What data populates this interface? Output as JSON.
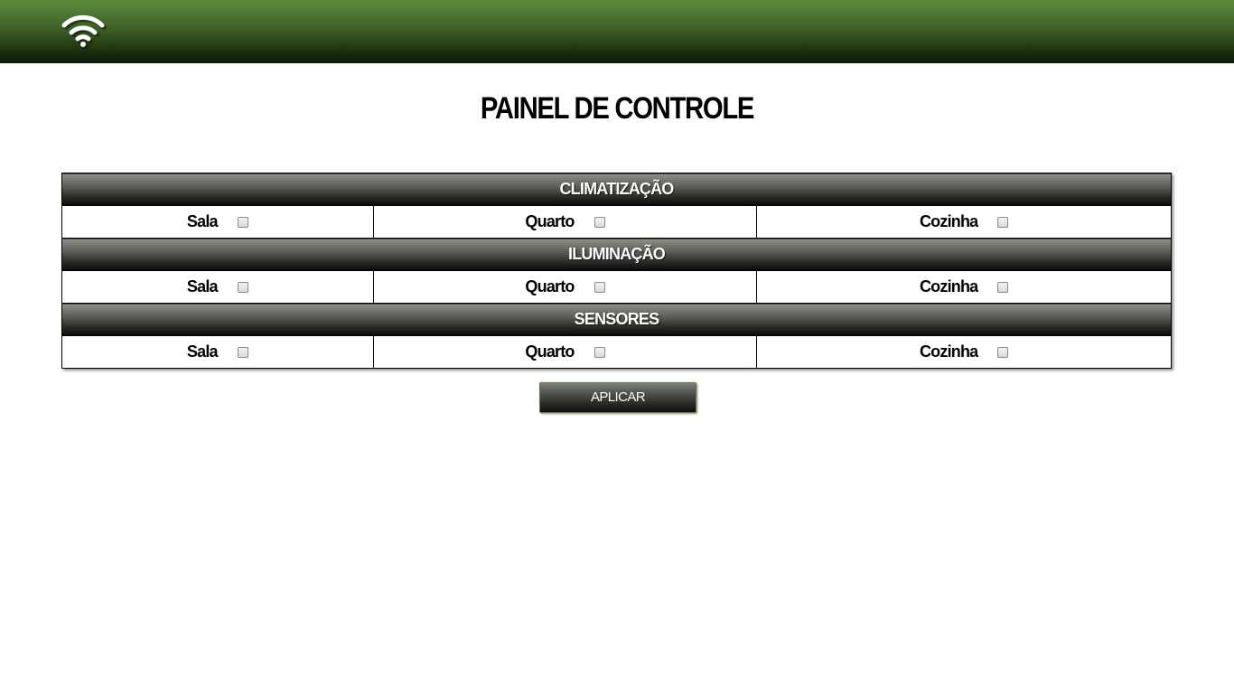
{
  "header": {
    "icon": "wifi-icon",
    "brand_color": "#3e6127"
  },
  "page": {
    "title": "PAINEL DE CONTROLE"
  },
  "sections": [
    {
      "title": "CLIMATIZAÇÃO",
      "rooms": [
        {
          "label": "Sala",
          "checked": false
        },
        {
          "label": "Quarto",
          "checked": false
        },
        {
          "label": "Cozinha",
          "checked": false
        }
      ]
    },
    {
      "title": "ILUMINAÇÃO",
      "rooms": [
        {
          "label": "Sala",
          "checked": false
        },
        {
          "label": "Quarto",
          "checked": false
        },
        {
          "label": "Cozinha",
          "checked": false
        }
      ]
    },
    {
      "title": "SENSORES",
      "rooms": [
        {
          "label": "Sala",
          "checked": false
        },
        {
          "label": "Quarto",
          "checked": false
        },
        {
          "label": "Cozinha",
          "checked": false
        }
      ]
    }
  ],
  "actions": {
    "apply_label": "APLICAR"
  }
}
